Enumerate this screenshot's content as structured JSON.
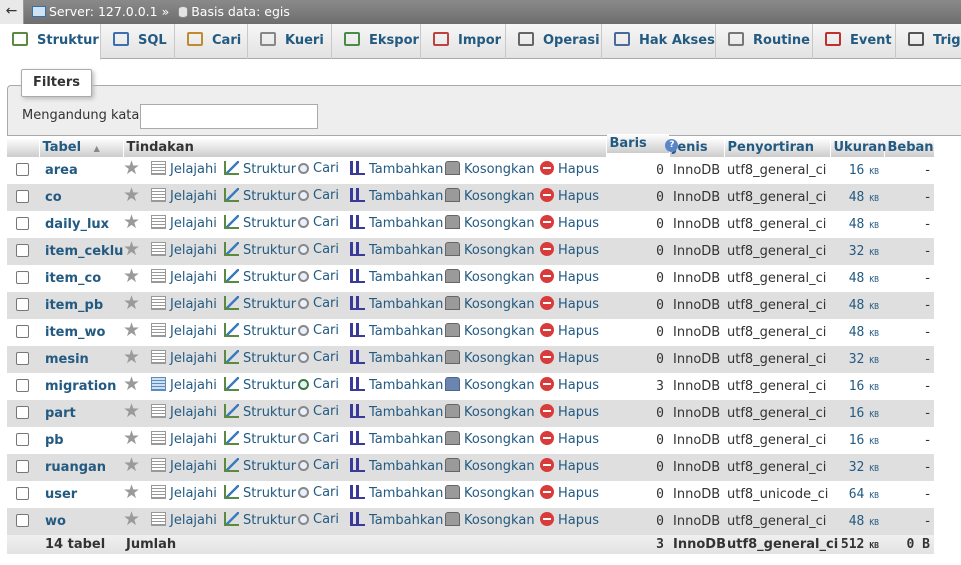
{
  "breadcrumb": {
    "back": "←",
    "server": "Server: 127.0.0.1",
    "sep": "»",
    "database": "Basis data: egis"
  },
  "tabs": [
    {
      "label": "Struktur",
      "icon": "structure-icon",
      "active": true
    },
    {
      "label": "SQL",
      "icon": "sql-icon"
    },
    {
      "label": "Cari",
      "icon": "search-icon"
    },
    {
      "label": "Kueri",
      "icon": "query-icon"
    },
    {
      "label": "Ekspor",
      "icon": "export-icon"
    },
    {
      "label": "Impor",
      "icon": "import-icon"
    },
    {
      "label": "Operasi",
      "icon": "wrench-icon"
    },
    {
      "label": "Hak Akses",
      "icon": "privileges-icon"
    },
    {
      "label": "Routine",
      "icon": "routine-icon"
    },
    {
      "label": "Event",
      "icon": "clock-icon"
    },
    {
      "label": "Trigg",
      "icon": "trigger-icon"
    }
  ],
  "filters": {
    "legend": "Filters",
    "label": "Mengandung kata:",
    "value": ""
  },
  "table": {
    "headers": {
      "table": "Tabel",
      "sort_arrow": "▲",
      "actions": "Tindakan",
      "rows": "Baris",
      "help": "?",
      "type": "Jenis",
      "collation": "Penyortiran",
      "size": "Ukuran",
      "overhead": "Beban"
    },
    "actions": {
      "browse": "Jelajahi",
      "structure": "Struktur",
      "search": "Cari",
      "insert": "Tambahkan",
      "empty": "Kosongkan",
      "drop": "Hapus"
    },
    "star": "★",
    "rows": [
      {
        "name": "area",
        "rows": "0",
        "type": "InnoDB",
        "collation": "utf8_general_ci",
        "size": "16",
        "unit": "KB",
        "overhead": "-"
      },
      {
        "name": "co",
        "rows": "0",
        "type": "InnoDB",
        "collation": "utf8_general_ci",
        "size": "48",
        "unit": "KB",
        "overhead": "-"
      },
      {
        "name": "daily_lux",
        "rows": "0",
        "type": "InnoDB",
        "collation": "utf8_general_ci",
        "size": "48",
        "unit": "KB",
        "overhead": "-"
      },
      {
        "name": "item_ceklux",
        "rows": "0",
        "type": "InnoDB",
        "collation": "utf8_general_ci",
        "size": "32",
        "unit": "KB",
        "overhead": "-"
      },
      {
        "name": "item_co",
        "rows": "0",
        "type": "InnoDB",
        "collation": "utf8_general_ci",
        "size": "48",
        "unit": "KB",
        "overhead": "-"
      },
      {
        "name": "item_pb",
        "rows": "0",
        "type": "InnoDB",
        "collation": "utf8_general_ci",
        "size": "48",
        "unit": "KB",
        "overhead": "-"
      },
      {
        "name": "item_wo",
        "rows": "0",
        "type": "InnoDB",
        "collation": "utf8_general_ci",
        "size": "48",
        "unit": "KB",
        "overhead": "-"
      },
      {
        "name": "mesin",
        "rows": "0",
        "type": "InnoDB",
        "collation": "utf8_general_ci",
        "size": "32",
        "unit": "KB",
        "overhead": "-"
      },
      {
        "name": "migration",
        "rows": "3",
        "type": "InnoDB",
        "collation": "utf8_general_ci",
        "size": "16",
        "unit": "KB",
        "overhead": "-",
        "has_data": true
      },
      {
        "name": "part",
        "rows": "0",
        "type": "InnoDB",
        "collation": "utf8_general_ci",
        "size": "16",
        "unit": "KB",
        "overhead": "-"
      },
      {
        "name": "pb",
        "rows": "0",
        "type": "InnoDB",
        "collation": "utf8_general_ci",
        "size": "16",
        "unit": "KB",
        "overhead": "-"
      },
      {
        "name": "ruangan",
        "rows": "0",
        "type": "InnoDB",
        "collation": "utf8_general_ci",
        "size": "32",
        "unit": "KB",
        "overhead": "-"
      },
      {
        "name": "user",
        "rows": "0",
        "type": "InnoDB",
        "collation": "utf8_unicode_ci",
        "size": "64",
        "unit": "KB",
        "overhead": "-"
      },
      {
        "name": "wo",
        "rows": "0",
        "type": "InnoDB",
        "collation": "utf8_general_ci",
        "size": "48",
        "unit": "KB",
        "overhead": "-"
      }
    ],
    "footer": {
      "count": "14 tabel",
      "label": "Jumlah",
      "rows": "3",
      "type": "InnoDB",
      "collation": "utf8_general_ci",
      "size": "512",
      "unit": "KB",
      "overhead": "0 B"
    }
  }
}
